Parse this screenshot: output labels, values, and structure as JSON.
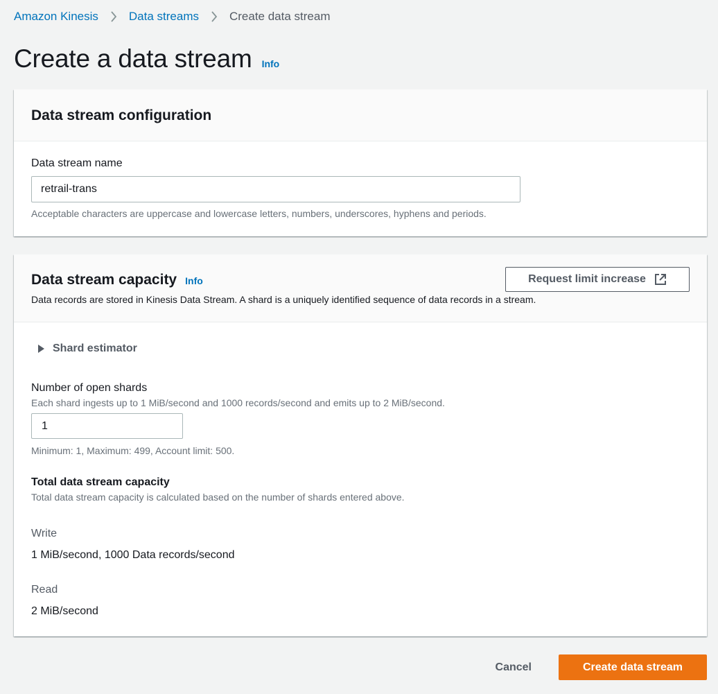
{
  "breadcrumb": {
    "items": [
      "Amazon Kinesis",
      "Data streams"
    ],
    "current": "Create data stream"
  },
  "page": {
    "title": "Create a data stream",
    "info": "Info"
  },
  "config_panel": {
    "title": "Data stream configuration",
    "name_label": "Data stream name",
    "name_value": "retrail-trans",
    "name_hint": "Acceptable characters are uppercase and lowercase letters, numbers, underscores, hyphens and periods."
  },
  "capacity_panel": {
    "title": "Data stream capacity",
    "info": "Info",
    "description": "Data records are stored in Kinesis Data Stream. A shard is a uniquely identified sequence of data records in a stream.",
    "request_button": "Request limit increase",
    "shard_estimator": "Shard estimator",
    "shards_label": "Number of open shards",
    "shards_desc": "Each shard ingests up to 1 MiB/second and 1000 records/second and emits up to 2 MiB/second.",
    "shards_value": "1",
    "shards_hint": "Minimum: 1, Maximum: 499, Account limit: 500.",
    "total_title": "Total data stream capacity",
    "total_desc": "Total data stream capacity is calculated based on the number of shards entered above.",
    "write_label": "Write",
    "write_value": "1 MiB/second, 1000 Data records/second",
    "read_label": "Read",
    "read_value": "2 MiB/second"
  },
  "actions": {
    "cancel": "Cancel",
    "create": "Create data stream"
  },
  "colors": {
    "link": "#0073bb",
    "primary": "#ec7211",
    "background": "#f2f3f3"
  },
  "icons": [
    "chevron-right-icon",
    "caret-right-icon",
    "external-link-icon"
  ]
}
